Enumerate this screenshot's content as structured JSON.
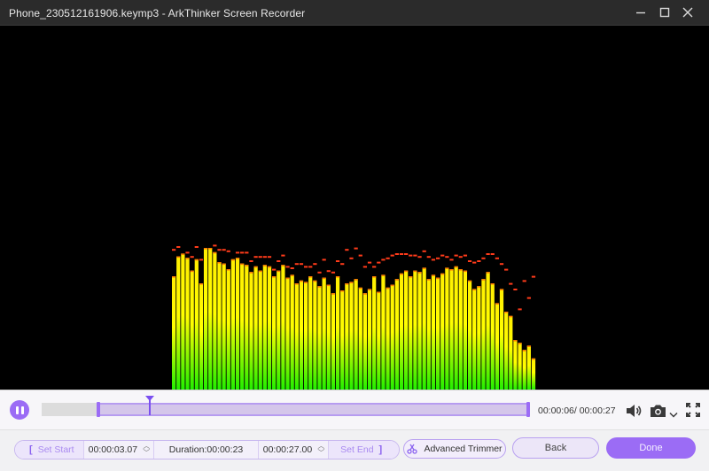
{
  "window": {
    "title": "Phone_230512161906.keymp3  -  ArkThinker Screen Recorder",
    "buttons": {
      "minimize": "minimize-icon",
      "maximize": "maximize-icon",
      "close": "close-icon"
    }
  },
  "visualizer": {
    "bar_count": 80,
    "levels": [
      0.8,
      0.94,
      0.96,
      0.93,
      0.84,
      0.92,
      0.75,
      1.0,
      1.0,
      0.97,
      0.9,
      0.89,
      0.85,
      0.92,
      0.93,
      0.89,
      0.88,
      0.83,
      0.87,
      0.84,
      0.88,
      0.87,
      0.8,
      0.84,
      0.88,
      0.79,
      0.81,
      0.75,
      0.77,
      0.76,
      0.8,
      0.77,
      0.73,
      0.79,
      0.74,
      0.68,
      0.8,
      0.7,
      0.75,
      0.76,
      0.78,
      0.72,
      0.68,
      0.71,
      0.8,
      0.69,
      0.81,
      0.72,
      0.74,
      0.78,
      0.82,
      0.84,
      0.8,
      0.84,
      0.83,
      0.86,
      0.78,
      0.81,
      0.79,
      0.82,
      0.86,
      0.85,
      0.87,
      0.85,
      0.84,
      0.77,
      0.71,
      0.73,
      0.78,
      0.83,
      0.75,
      0.61,
      0.71,
      0.55,
      0.52,
      0.35,
      0.33,
      0.28,
      0.31,
      0.22
    ],
    "peaks": [
      0.98,
      1.0,
      0.97,
      0.96,
      0.93,
      1.0,
      0.91,
      1.0,
      1.0,
      1.01,
      0.98,
      0.98,
      0.97,
      0.91,
      0.96,
      0.96,
      0.96,
      0.9,
      0.93,
      0.93,
      0.93,
      0.93,
      0.84,
      0.9,
      0.94,
      0.86,
      0.85,
      0.88,
      0.88,
      0.86,
      0.86,
      0.88,
      0.82,
      0.91,
      0.83,
      0.82,
      0.9,
      0.88,
      0.98,
      0.92,
      0.99,
      0.94,
      0.86,
      0.89,
      0.86,
      0.89,
      0.91,
      0.92,
      0.94,
      0.95,
      0.95,
      0.95,
      0.94,
      0.94,
      0.93,
      0.97,
      0.93,
      0.91,
      0.92,
      0.94,
      0.93,
      0.91,
      0.94,
      0.93,
      0.94,
      0.9,
      0.89,
      0.9,
      0.92,
      0.95,
      0.95,
      0.92,
      0.88,
      0.84,
      0.74,
      0.7,
      0.56,
      0.76,
      0.64,
      0.79
    ]
  },
  "player": {
    "play_state": "playing",
    "position_fraction": 0.222,
    "selection_start_fraction": 0.114,
    "selection_end_fraction": 1.0,
    "time_readout": "00:00:06/ 00:00:27",
    "volume_icon": "volume-icon",
    "snapshot_icon": "camera-icon",
    "fullscreen_icon": "fullscreen-icon"
  },
  "trim": {
    "set_start_label": "Set Start",
    "start_time": "00:00:03.07",
    "duration": "Duration:00:00:23",
    "end_time": "00:00:27.00",
    "set_end_label": "Set End",
    "advanced_trimmer_label": "Advanced Trimmer",
    "back_label": "Back",
    "done_label": "Done"
  },
  "colors": {
    "accent": "#9b6cf5",
    "bar_top": "#ffee00",
    "bar_bottom": "#22ee00",
    "peak": "#ff3b1a"
  }
}
